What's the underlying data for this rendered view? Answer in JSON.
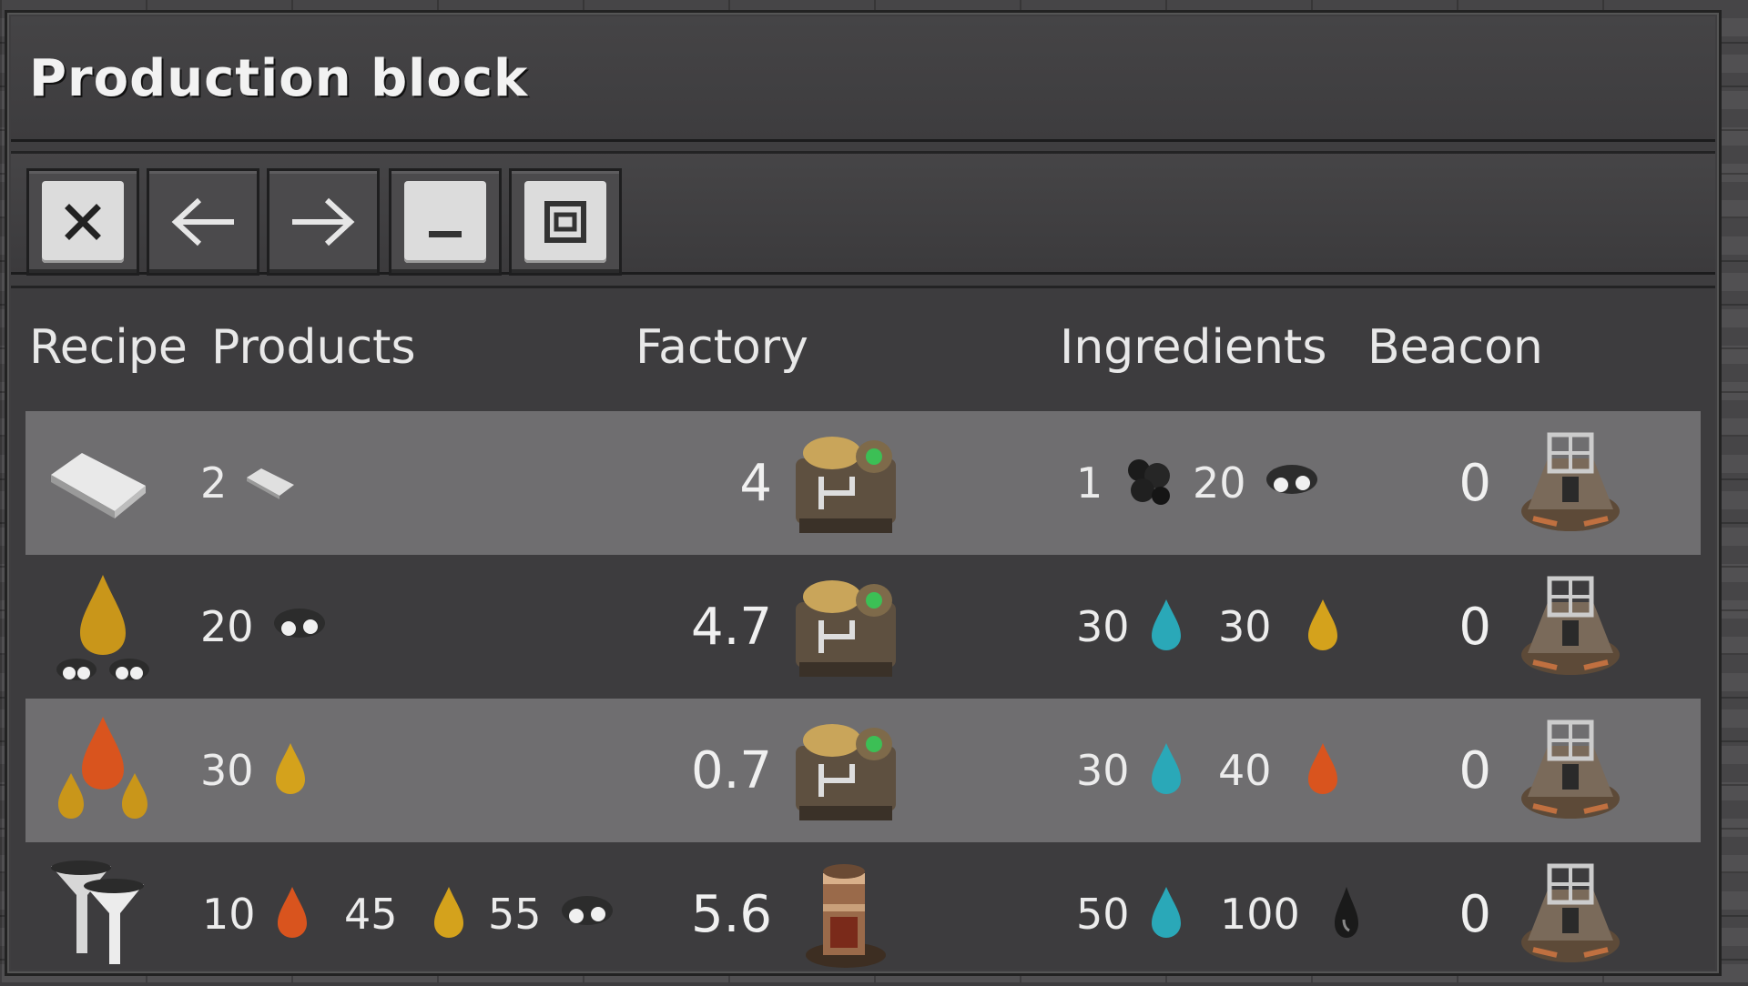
{
  "window": {
    "title": "Production block"
  },
  "toolbar": {
    "buttons": [
      {
        "name": "close-button",
        "icon": "close-icon"
      },
      {
        "name": "back-button",
        "icon": "arrow-left-icon"
      },
      {
        "name": "forward-button",
        "icon": "arrow-right-icon"
      },
      {
        "name": "minimize-button",
        "icon": "minimize-icon"
      },
      {
        "name": "maximize-button",
        "icon": "maximize-icon"
      }
    ]
  },
  "table": {
    "headers": {
      "recipe": "Recipe",
      "products": "Products",
      "factory": "Factory",
      "ingredients": "Ingredients",
      "beacon": "Beacon"
    },
    "rows": [
      {
        "recipe_icon": "plastic-bar-icon",
        "products": [
          {
            "amount": "2",
            "icon": "plastic-bar-icon"
          }
        ],
        "factory_count": "4",
        "factory_icon": "chemical-plant-icon",
        "ingredients": [
          {
            "amount": "1",
            "icon": "coal-icon"
          },
          {
            "amount": "20",
            "icon": "petroleum-gas-icon"
          }
        ],
        "beacon_count": "0",
        "beacon_icon": "beacon-icon"
      },
      {
        "recipe_icon": "light-oil-cracking-icon",
        "products": [
          {
            "amount": "20",
            "icon": "petroleum-gas-icon"
          }
        ],
        "factory_count": "4.7",
        "factory_icon": "chemical-plant-icon",
        "ingredients": [
          {
            "amount": "30",
            "icon": "water-icon"
          },
          {
            "amount": "30",
            "icon": "light-oil-icon"
          }
        ],
        "beacon_count": "0",
        "beacon_icon": "beacon-icon"
      },
      {
        "recipe_icon": "heavy-oil-cracking-icon",
        "products": [
          {
            "amount": "30",
            "icon": "light-oil-icon"
          }
        ],
        "factory_count": "0.7",
        "factory_icon": "chemical-plant-icon",
        "ingredients": [
          {
            "amount": "30",
            "icon": "water-icon"
          },
          {
            "amount": "40",
            "icon": "heavy-oil-icon"
          }
        ],
        "beacon_count": "0",
        "beacon_icon": "beacon-icon"
      },
      {
        "recipe_icon": "advanced-oil-processing-icon",
        "products": [
          {
            "amount": "10",
            "icon": "heavy-oil-icon"
          },
          {
            "amount": "45",
            "icon": "light-oil-icon"
          },
          {
            "amount": "55",
            "icon": "petroleum-gas-icon"
          }
        ],
        "factory_count": "5.6",
        "factory_icon": "oil-refinery-icon",
        "ingredients": [
          {
            "amount": "50",
            "icon": "water-icon"
          },
          {
            "amount": "100",
            "icon": "crude-oil-icon"
          }
        ],
        "beacon_count": "0",
        "beacon_icon": "beacon-icon"
      }
    ]
  },
  "colors": {
    "water": "#2aa8b8",
    "light_oil": "#d4a21c",
    "heavy_oil": "#d9541e",
    "crude_oil": "#1a1a1a",
    "row_highlight": "#6f6e70"
  }
}
